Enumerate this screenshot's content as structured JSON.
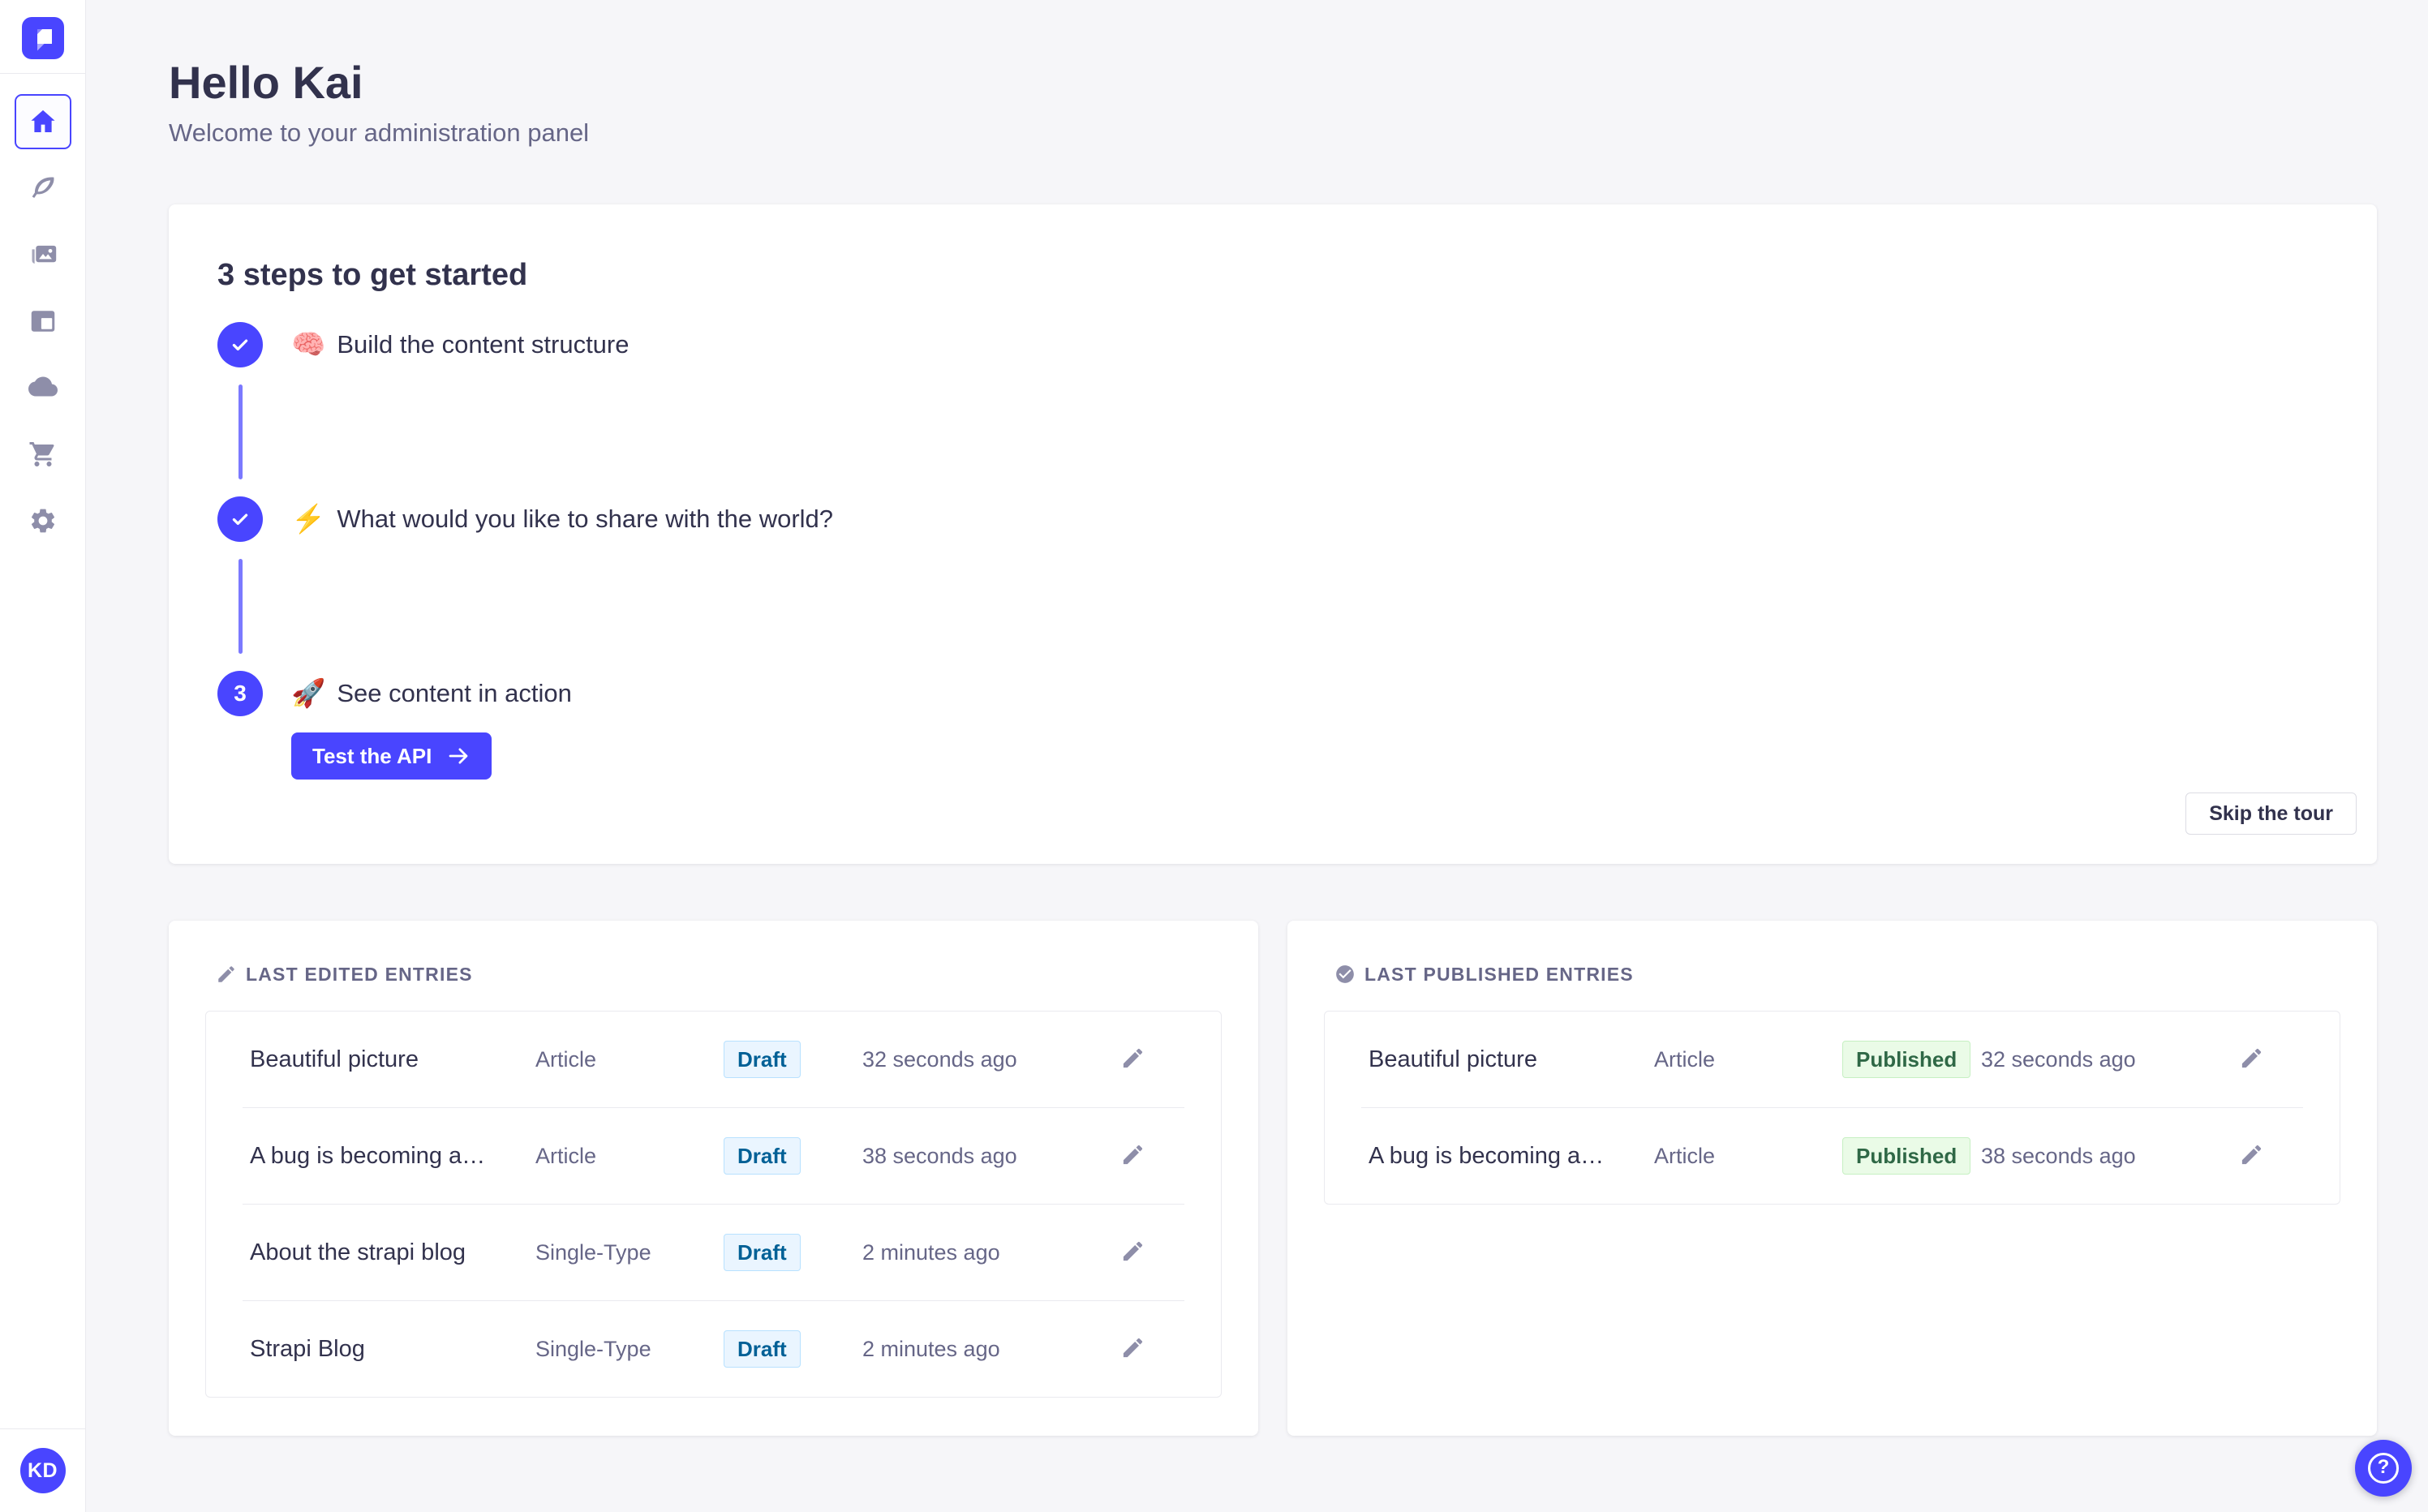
{
  "header": {
    "title": "Hello Kai",
    "subtitle": "Welcome to your administration panel"
  },
  "sidebar": {
    "avatar_initials": "KD",
    "items": [
      {
        "icon": "home-icon",
        "active": true
      },
      {
        "icon": "feather-icon",
        "active": false
      },
      {
        "icon": "media-library-icon",
        "active": false
      },
      {
        "icon": "layout-icon",
        "active": false
      },
      {
        "icon": "cloud-icon",
        "active": false
      },
      {
        "icon": "cart-icon",
        "active": false
      },
      {
        "icon": "gear-icon",
        "active": false
      }
    ]
  },
  "onboarding": {
    "title": "3 steps to get started",
    "steps": [
      {
        "state": "done",
        "emoji": "🧠",
        "label": "Build the content structure"
      },
      {
        "state": "done",
        "emoji": "⚡",
        "label": "What would you like to share with the world?"
      },
      {
        "state": "active",
        "number": "3",
        "emoji": "🚀",
        "label": "See content in action",
        "cta_label": "Test the API"
      }
    ],
    "skip_label": "Skip the tour"
  },
  "last_edited": {
    "title": "LAST EDITED ENTRIES",
    "rows": [
      {
        "title": "Beautiful picture",
        "type": "Article",
        "status": "Draft",
        "time": "32 seconds ago"
      },
      {
        "title": "A bug is becoming a…",
        "type": "Article",
        "status": "Draft",
        "time": "38 seconds ago"
      },
      {
        "title": "About the strapi blog",
        "type": "Single-Type",
        "status": "Draft",
        "time": "2 minutes ago"
      },
      {
        "title": "Strapi Blog",
        "type": "Single-Type",
        "status": "Draft",
        "time": "2 minutes ago"
      }
    ]
  },
  "last_published": {
    "title": "LAST PUBLISHED ENTRIES",
    "rows": [
      {
        "title": "Beautiful picture",
        "type": "Article",
        "status": "Published",
        "time": "32 seconds ago"
      },
      {
        "title": "A bug is becoming a…",
        "type": "Article",
        "status": "Published",
        "time": "38 seconds ago"
      }
    ]
  },
  "icons": {
    "help_glyph": "?"
  },
  "colors": {
    "primary": "#4945ff",
    "connector": "#7b79ff",
    "text_dark": "#32324d",
    "text_gray": "#666687",
    "icon_gray": "#8e8ea9",
    "page_bg": "#f6f6f9",
    "card_border": "#eaeaef",
    "draft_bg": "#eaf5ff",
    "draft_border": "#b8e1ff",
    "draft_text": "#006096",
    "published_bg": "#eafbe7",
    "published_border": "#c6f0c2",
    "published_text": "#2f6846"
  }
}
